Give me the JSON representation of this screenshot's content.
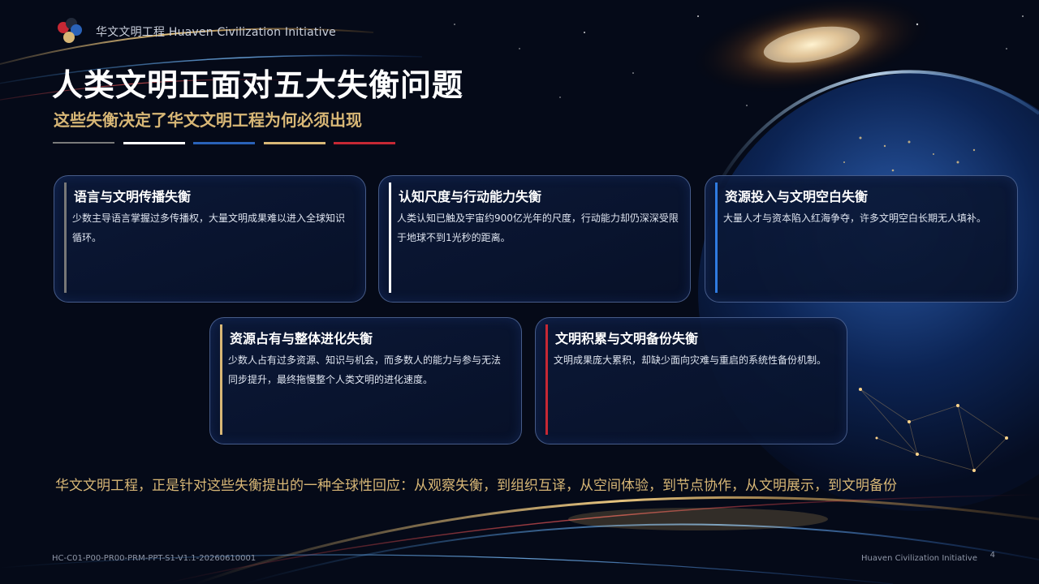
{
  "header": {
    "brand": "华文文明工程 Huaven Civilization Initiative"
  },
  "title": "人类文明正面对五大失衡问题",
  "subtitle": "这些失衡决定了华文文明工程为何必须出现",
  "colors": {
    "gold": "#d8b776",
    "divider": [
      "#7a7a7a",
      "#ffffff",
      "#2a62b8",
      "#d8b776",
      "#c62834"
    ],
    "card_bar": [
      "#777777",
      "#ffffff",
      "#2f7be0",
      "#d8b776",
      "#c62834"
    ]
  },
  "cards": [
    {
      "title": "语言与文明传播失衡",
      "body": "少数主导语言掌握过多传播权，大量文明成果难以进入全球知识循环。"
    },
    {
      "title": "认知尺度与行动能力失衡",
      "body": "人类认知已触及宇宙约900亿光年的尺度，行动能力却仍深深受限于地球不到1光秒的距离。"
    },
    {
      "title": "资源投入与文明空白失衡",
      "body": "大量人才与资本陷入红海争夺，许多文明空白长期无人填补。"
    },
    {
      "title": "资源占有与整体进化失衡",
      "body": "少数人占有过多资源、知识与机会，而多数人的能力与参与无法同步提升，最终拖慢整个人类文明的进化速度。"
    },
    {
      "title": "文明积累与文明备份失衡",
      "body": "文明成果庞大累积，却缺少面向灾难与重启的系统性备份机制。"
    }
  ],
  "conclusion": "华文文明工程，正是针对这些失衡提出的一种全球性回应：从观察失衡，到组织互译，从空间体验，到节点协作，从文明展示，到文明备份",
  "footer": {
    "doc_code": "HC-C01-P00-PR00-PRM-PPT-S1-V1.1-20260610001",
    "brand": "Huaven Civilization Initiative",
    "page": "4"
  }
}
